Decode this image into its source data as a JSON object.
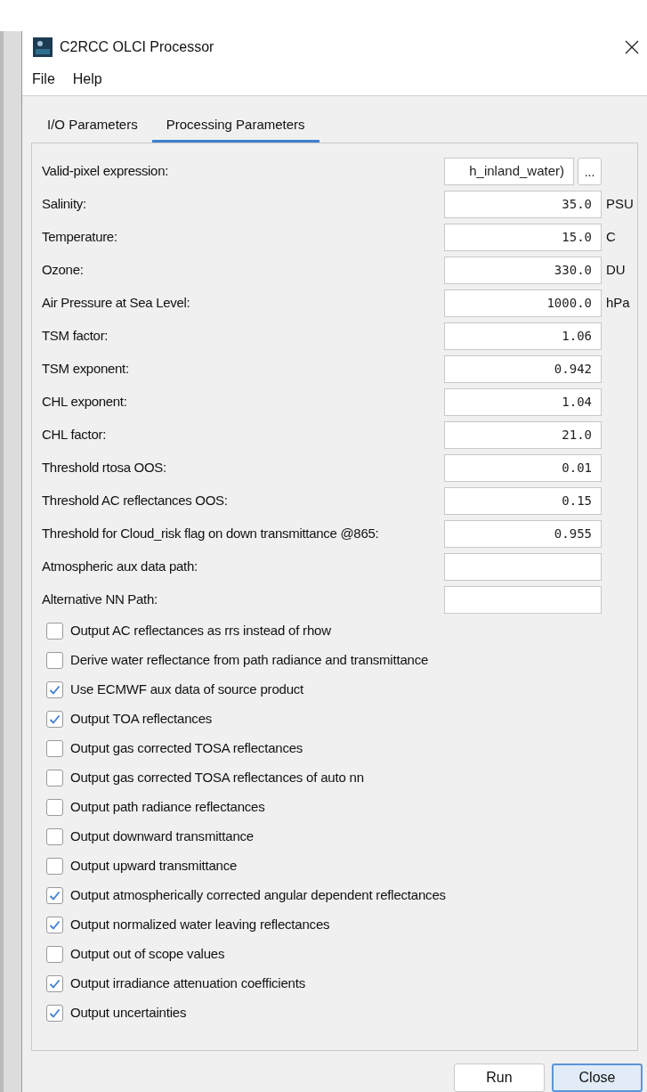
{
  "window": {
    "title": "C2RCC OLCI Processor"
  },
  "menu": [
    "File",
    "Help"
  ],
  "tabs": [
    {
      "label": "I/O Parameters",
      "selected": false
    },
    {
      "label": "Processing Parameters",
      "selected": true
    }
  ],
  "parameters": [
    {
      "kind": "expression",
      "label": "Valid-pixel expression:",
      "value": "h_inland_water)",
      "button": "..."
    },
    {
      "kind": "number",
      "label": "Salinity:",
      "value": "35.0",
      "unit": "PSU"
    },
    {
      "kind": "number",
      "label": "Temperature:",
      "value": "15.0",
      "unit": "C"
    },
    {
      "kind": "number",
      "label": "Ozone:",
      "value": "330.0",
      "unit": "DU"
    },
    {
      "kind": "number",
      "label": "Air Pressure at Sea Level:",
      "value": "1000.0",
      "unit": "hPa"
    },
    {
      "kind": "number",
      "label": "TSM factor:",
      "value": "1.06"
    },
    {
      "kind": "number",
      "label": "TSM exponent:",
      "value": "0.942"
    },
    {
      "kind": "number",
      "label": "CHL exponent:",
      "value": "1.04"
    },
    {
      "kind": "number",
      "label": "CHL factor:",
      "value": "21.0"
    },
    {
      "kind": "number",
      "label": "Threshold rtosa OOS:",
      "value": "0.01"
    },
    {
      "kind": "number",
      "label": "Threshold AC reflectances OOS:",
      "value": "0.15"
    },
    {
      "kind": "number",
      "label": "Threshold for Cloud_risk flag on down transmittance @865:",
      "value": "0.955"
    },
    {
      "kind": "number",
      "label": "Atmospheric aux data path:"
    },
    {
      "kind": "number",
      "label": "Alternative NN Path:"
    }
  ],
  "options": [
    {
      "label": "Output AC reflectances as rrs instead of rhow",
      "checked": false
    },
    {
      "label": "Derive water reflectance from path radiance and transmittance",
      "checked": false
    },
    {
      "label": "Use ECMWF aux data of source product",
      "checked": true
    },
    {
      "label": "Output TOA reflectances",
      "checked": true
    },
    {
      "label": "Output gas corrected TOSA reflectances",
      "checked": false
    },
    {
      "label": "Output gas corrected TOSA reflectances of auto nn",
      "checked": false
    },
    {
      "label": "Output path radiance reflectances",
      "checked": false
    },
    {
      "label": "Output downward transmittance",
      "checked": false
    },
    {
      "label": "Output upward transmittance",
      "checked": false
    },
    {
      "label": "Output atmospherically corrected angular dependent reflectances",
      "checked": true
    },
    {
      "label": "Output normalized water leaving reflectances",
      "checked": true
    },
    {
      "label": "Output out of scope values",
      "checked": false
    },
    {
      "label": "Output irradiance attenuation coefficients",
      "checked": true
    },
    {
      "label": "Output uncertainties",
      "checked": true
    }
  ],
  "buttons": [
    {
      "label": "Run",
      "selected": false
    },
    {
      "label": "Close",
      "selected": true
    }
  ]
}
